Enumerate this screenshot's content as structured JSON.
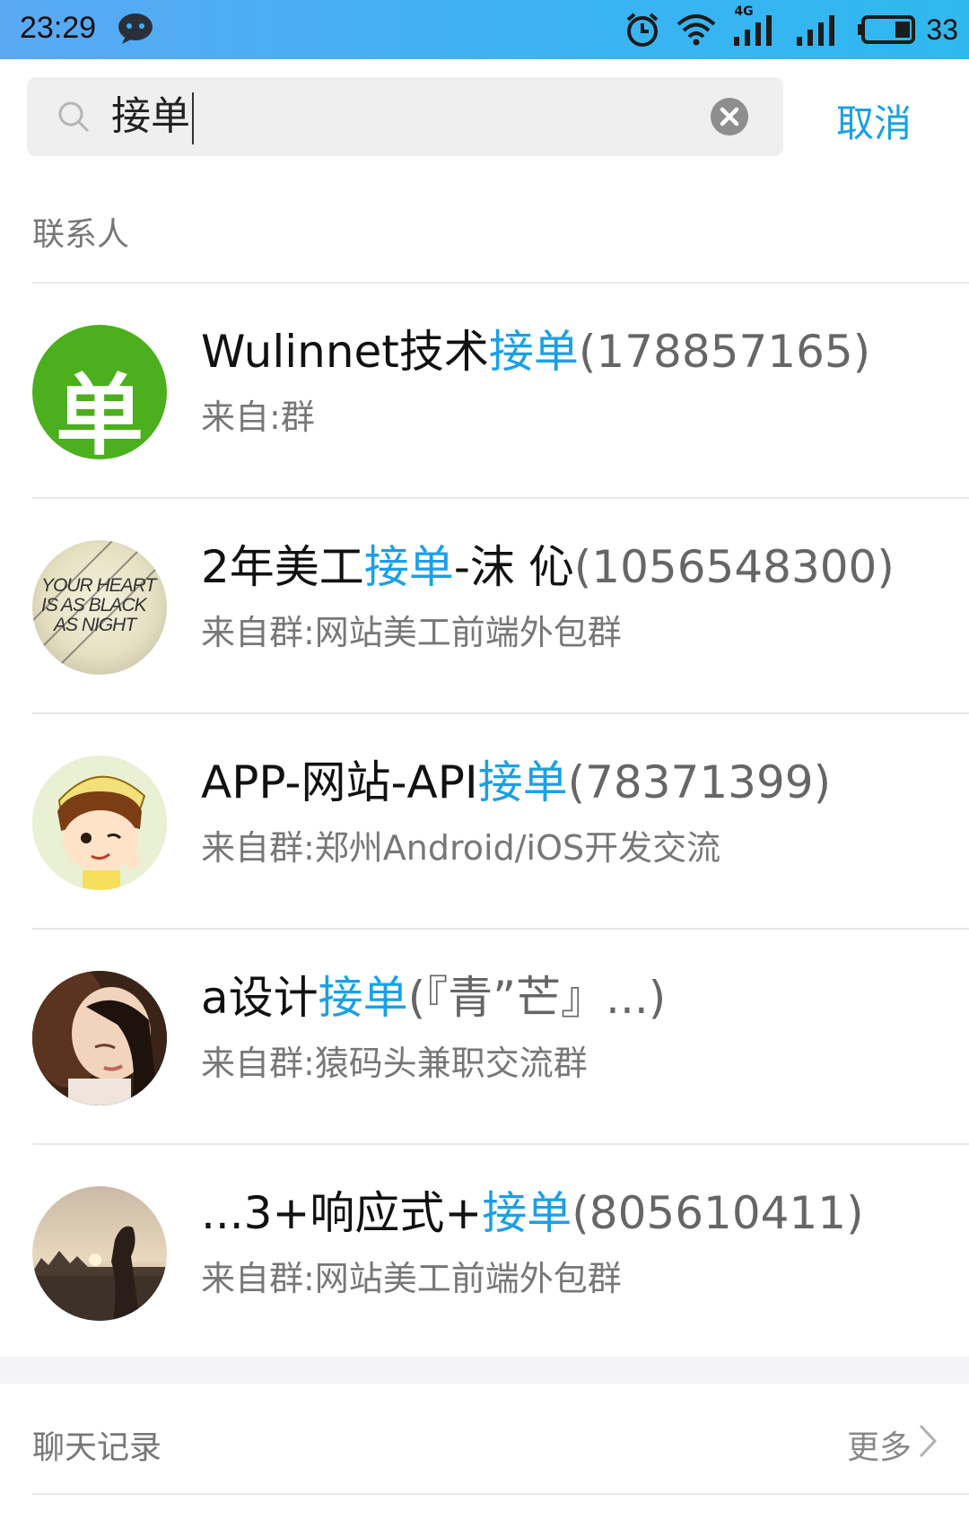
{
  "status_bar": {
    "time": "23:29",
    "network": "4G",
    "battery_percent": "33",
    "icons": [
      "chat-notification-icon",
      "alarm-icon",
      "wifi-icon",
      "signal-4g-icon",
      "signal-icon",
      "battery-icon"
    ]
  },
  "search": {
    "query": "接单",
    "cancel_label": "取消"
  },
  "contacts_section": {
    "title": "联系人",
    "items": [
      {
        "name_before": "Wulinnet技术",
        "highlight": "接单",
        "name_after": "(178857165)",
        "subtitle": "来自:群",
        "avatar": "single-char-badge",
        "avatar_char": "单",
        "avatar_color": "#4caf1e"
      },
      {
        "name_before": "2年美工",
        "highlight": "接单",
        "name_after": "-沫  伈",
        "id_part": "(1056548300)",
        "subtitle": "来自群:网站美工前端外包群",
        "avatar": "text-art",
        "avatar_lines": [
          "YOUR HEART",
          "IS AS BLACK",
          "AS NIGHT"
        ]
      },
      {
        "name_before": "APP-网站-API",
        "highlight": "接单",
        "name_after": "(78371399)",
        "subtitle": "来自群:郑州Android/iOS开发交流",
        "avatar": "cartoon-boy"
      },
      {
        "name_before": "a设计",
        "highlight": "接单",
        "name_after": "(『青”芒』...)",
        "subtitle": "来自群:猿码头兼职交流群",
        "avatar": "portrait-photo"
      },
      {
        "name_before": "...3+响应式+",
        "highlight": "接单",
        "name_after": "(805610411)",
        "subtitle": "来自群:网站美工前端外包群",
        "avatar": "sunset-photo"
      }
    ]
  },
  "chat_history_section": {
    "title": "聊天记录",
    "more_label": "更多"
  },
  "colors": {
    "accent": "#1aa0e6",
    "status_bar": "#3bb3f3"
  }
}
